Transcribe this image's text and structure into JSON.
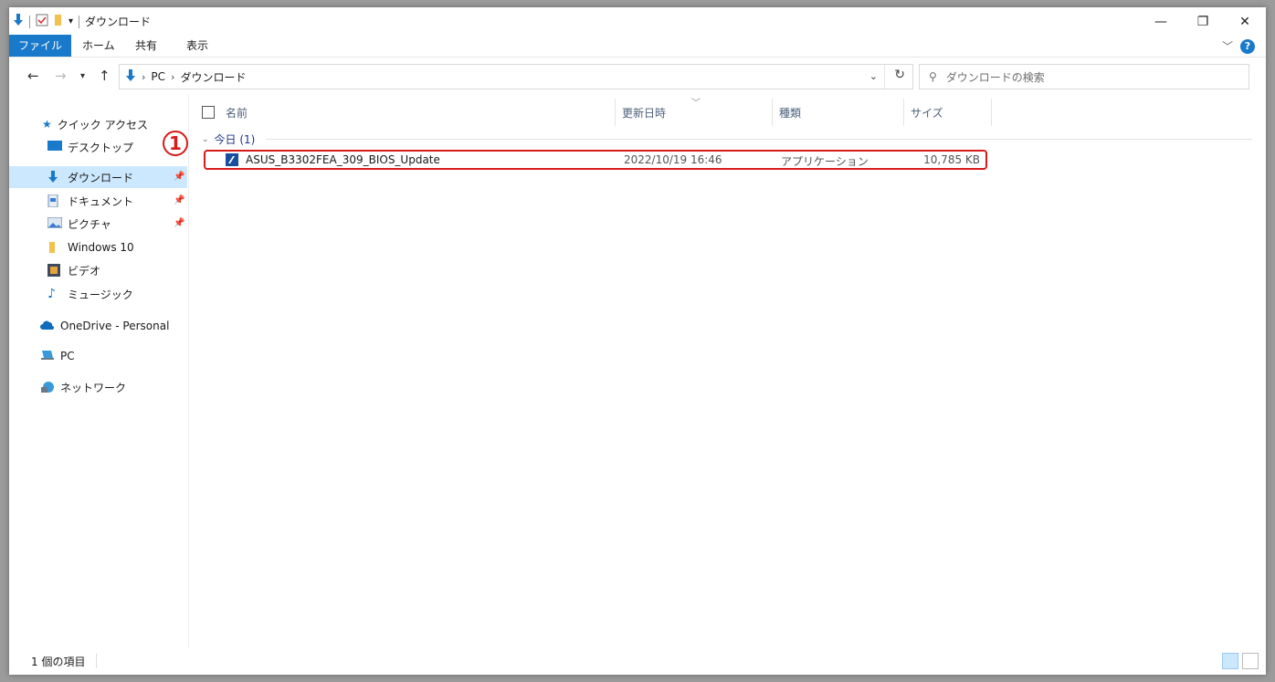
{
  "title": "ダウンロード",
  "ribbon": {
    "tabs": [
      "ファイル",
      "ホーム",
      "共有",
      "表示"
    ]
  },
  "nav": {
    "breadcrumb": [
      "PC",
      "ダウンロード"
    ],
    "search_placeholder": "ダウンロードの検索"
  },
  "sidebar": {
    "items": [
      {
        "label": "クイック アクセス",
        "icon": "star-icon"
      },
      {
        "label": "デスクトップ",
        "icon": "desktop-icon",
        "pinned": true
      },
      {
        "label": "ダウンロード",
        "icon": "download-icon",
        "pinned": true,
        "selected": true
      },
      {
        "label": "ドキュメント",
        "icon": "document-icon",
        "pinned": true
      },
      {
        "label": "ピクチャ",
        "icon": "picture-icon",
        "pinned": true
      },
      {
        "label": "Windows 10",
        "icon": "folder-icon"
      },
      {
        "label": "ビデオ",
        "icon": "video-icon"
      },
      {
        "label": "ミュージック",
        "icon": "music-icon"
      },
      {
        "label": "OneDrive - Personal",
        "icon": "cloud-icon"
      },
      {
        "label": "PC",
        "icon": "pc-icon"
      },
      {
        "label": "ネットワーク",
        "icon": "network-icon"
      }
    ]
  },
  "columns": [
    "名前",
    "更新日時",
    "種類",
    "サイズ"
  ],
  "group": {
    "label": "今日 (1)"
  },
  "files": [
    {
      "name": "ASUS_B3302FEA_309_BIOS_Update",
      "date": "2022/10/19 16:46",
      "type": "アプリケーション",
      "size": "10,785 KB"
    }
  ],
  "annotation": "1",
  "status": {
    "count": "1 個の項目"
  },
  "colors": {
    "accent": "#1979ca",
    "highlight": "#d71b1b",
    "selected": "#cce8ff"
  }
}
